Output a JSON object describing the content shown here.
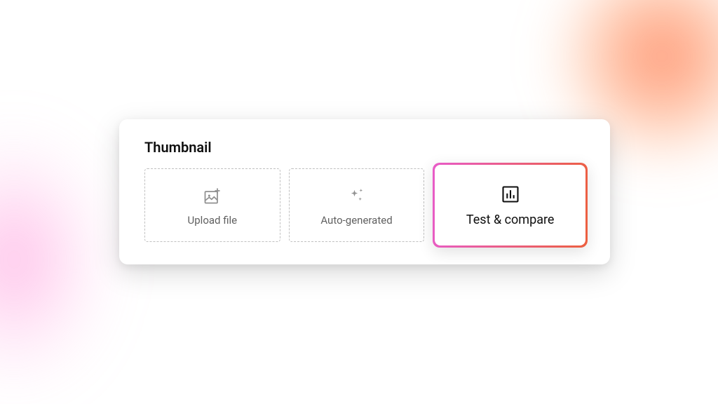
{
  "card": {
    "title": "Thumbnail",
    "options": [
      {
        "label": "Upload file",
        "icon": "image-plus-icon"
      },
      {
        "label": "Auto-generated",
        "icon": "sparkles-icon"
      },
      {
        "label": "Test & compare",
        "icon": "bar-chart-icon"
      }
    ]
  },
  "colors": {
    "gradient_start": "#e85cc8",
    "gradient_end": "#ec5f3f"
  }
}
